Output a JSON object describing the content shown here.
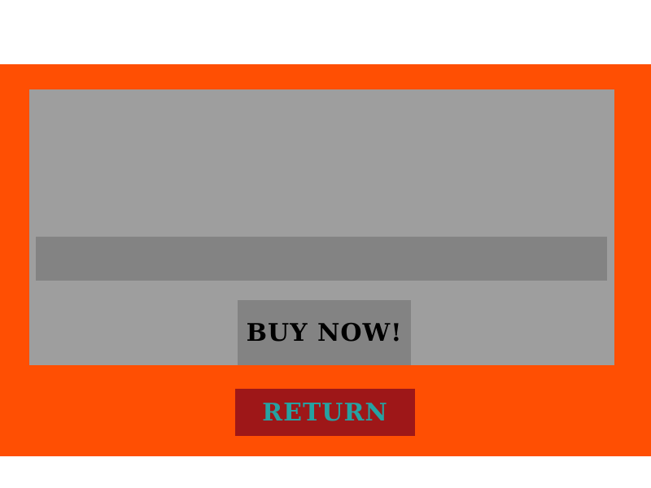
{
  "colors": {
    "background": "#ffffff",
    "band": "#ff4f03",
    "card": "#9e9e9e",
    "strip": "#838383",
    "buy_button_bg": "#838383",
    "buy_button_text": "#000000",
    "return_button_bg": "#9e1718",
    "return_button_text": "#26a2a2"
  },
  "buy_button": {
    "label": "BUY NOW!"
  },
  "return_button": {
    "label": "RETURN"
  }
}
